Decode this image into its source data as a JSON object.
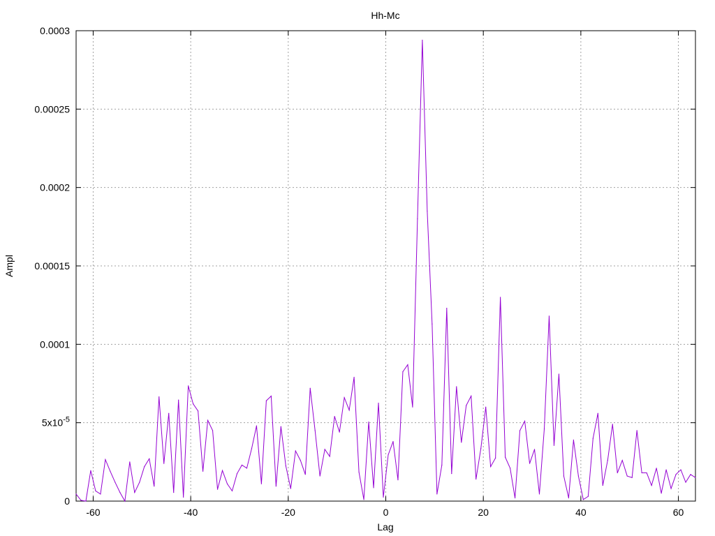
{
  "chart_data": {
    "type": "line",
    "title": "Hh-Mc",
    "xlabel": "Lag",
    "ylabel": "Ampl",
    "xlim": [
      -63.5,
      63.5
    ],
    "ylim": [
      0,
      0.0003
    ],
    "grid": true,
    "line_color": "#9400d3",
    "x_ticks": [
      {
        "value": -60,
        "label": "-60"
      },
      {
        "value": -40,
        "label": "-40"
      },
      {
        "value": -20,
        "label": "-20"
      },
      {
        "value": 0,
        "label": "0"
      },
      {
        "value": 20,
        "label": "20"
      },
      {
        "value": 40,
        "label": "40"
      },
      {
        "value": 60,
        "label": "60"
      }
    ],
    "y_ticks": [
      {
        "value": 0,
        "label": "0"
      },
      {
        "value": 5e-05,
        "label": "5x10",
        "sup": "-5"
      },
      {
        "value": 0.0001,
        "label": "0.0001"
      },
      {
        "value": 0.00015,
        "label": "0.00015"
      },
      {
        "value": 0.0002,
        "label": "0.0002"
      },
      {
        "value": 0.00025,
        "label": "0.00025"
      },
      {
        "value": 0.0003,
        "label": "0.0003"
      }
    ],
    "series": [
      {
        "x": [
          -63.5,
          -62.5,
          -61.5,
          -60.5,
          -59.5,
          -58.5,
          -57.5,
          -56.5,
          -55.5,
          -54.5,
          -53.5,
          -52.5,
          -51.5,
          -50.5,
          -49.5,
          -48.5,
          -47.5,
          -46.5,
          -45.5,
          -44.5,
          -43.5,
          -42.5,
          -41.5,
          -40.5,
          -39.5,
          -38.5,
          -37.5,
          -36.5,
          -35.5,
          -34.5,
          -33.5,
          -32.5,
          -31.5,
          -30.5,
          -29.5,
          -28.5,
          -27.5,
          -26.5,
          -25.5,
          -24.5,
          -23.5,
          -22.5,
          -21.5,
          -20.5,
          -19.5,
          -18.5,
          -17.5,
          -16.5,
          -15.5,
          -14.5,
          -13.5,
          -12.5,
          -11.5,
          -10.5,
          -9.5,
          -8.5,
          -7.5,
          -6.5,
          -5.5,
          -4.5,
          -3.5,
          -2.5,
          -1.5,
          -0.5,
          0.5,
          1.5,
          2.5,
          3.5,
          4.5,
          5.5,
          6.5,
          7.5,
          8.5,
          9.5,
          10.5,
          11.5,
          12.5,
          13.5,
          14.5,
          15.5,
          16.5,
          17.5,
          18.5,
          19.5,
          20.5,
          21.5,
          22.5,
          23.5,
          24.5,
          25.5,
          26.5,
          27.5,
          28.5,
          29.5,
          30.5,
          31.5,
          32.5,
          33.5,
          34.5,
          35.5,
          36.5,
          37.5,
          38.5,
          39.5,
          40.5,
          41.5,
          42.5,
          43.5,
          44.5,
          45.5,
          46.5,
          47.5,
          48.5,
          49.5,
          50.5,
          51.5,
          52.5,
          53.5,
          54.5,
          55.5,
          56.5,
          57.5,
          58.5,
          59.5,
          60.5,
          61.5,
          62.5,
          63.5
        ],
        "y": [
          4.5e-06,
          5e-07,
          0,
          1.95e-05,
          6.5e-06,
          4.5e-06,
          2.65e-05,
          1.9e-05,
          1.2e-05,
          5.5e-06,
          0,
          2.5e-05,
          5.5e-06,
          1.2e-05,
          2.2e-05,
          2.7e-05,
          9.5e-06,
          6.65e-05,
          2.4e-05,
          5.6e-05,
          5.5e-06,
          6.45e-05,
          2.5e-06,
          7.35e-05,
          6.2e-05,
          5.75e-05,
          1.9e-05,
          5.15e-05,
          4.5e-05,
          7.5e-06,
          1.95e-05,
          1.1e-05,
          6.5e-06,
          1.75e-05,
          2.3e-05,
          2.1e-05,
          3.35e-05,
          4.8e-05,
          1.1e-05,
          6.4e-05,
          6.7e-05,
          9.5e-06,
          4.75e-05,
          2.25e-05,
          8e-06,
          3.2e-05,
          2.6e-05,
          1.7e-05,
          7.2e-05,
          4.5e-05,
          1.6e-05,
          3.3e-05,
          2.85e-05,
          5.4e-05,
          4.4e-05,
          6.6e-05,
          5.8e-05,
          7.9e-05,
          1.85e-05,
          1e-06,
          5.05e-05,
          8.5e-06,
          6.25e-05,
          2.5e-06,
          2.95e-05,
          3.8e-05,
          1.35e-05,
          8.25e-05,
          8.7e-05,
          6e-05,
          0.00018,
          0.000294,
          0.000185,
          0.000113,
          4.5e-06,
          2.3e-05,
          0.000123,
          1.75e-05,
          7.3e-05,
          3.75e-05,
          6.1e-05,
          6.7e-05,
          1.4e-05,
          3.35e-05,
          6e-05,
          2.2e-05,
          2.75e-05,
          0.00013,
          2.8e-05,
          2.1e-05,
          2e-06,
          4.5e-05,
          5.1e-05,
          2.4e-05,
          3.3e-05,
          4.5e-06,
          4.6e-05,
          0.000118,
          3.55e-05,
          8.1e-05,
          1.6e-05,
          2e-06,
          3.9e-05,
          1.6e-05,
          1e-06,
          3e-06,
          4e-05,
          5.6e-05,
          1e-05,
          2.6e-05,
          4.9e-05,
          1.8e-05,
          2.6e-05,
          1.6e-05,
          1.5e-05,
          4.5e-05,
          1.8e-05,
          1.8e-05,
          1e-05,
          2.1e-05,
          5e-06,
          2e-05,
          8e-06,
          1.7e-05,
          2e-05,
          1.2e-05,
          1.7e-05,
          1.5e-05
        ]
      }
    ]
  }
}
